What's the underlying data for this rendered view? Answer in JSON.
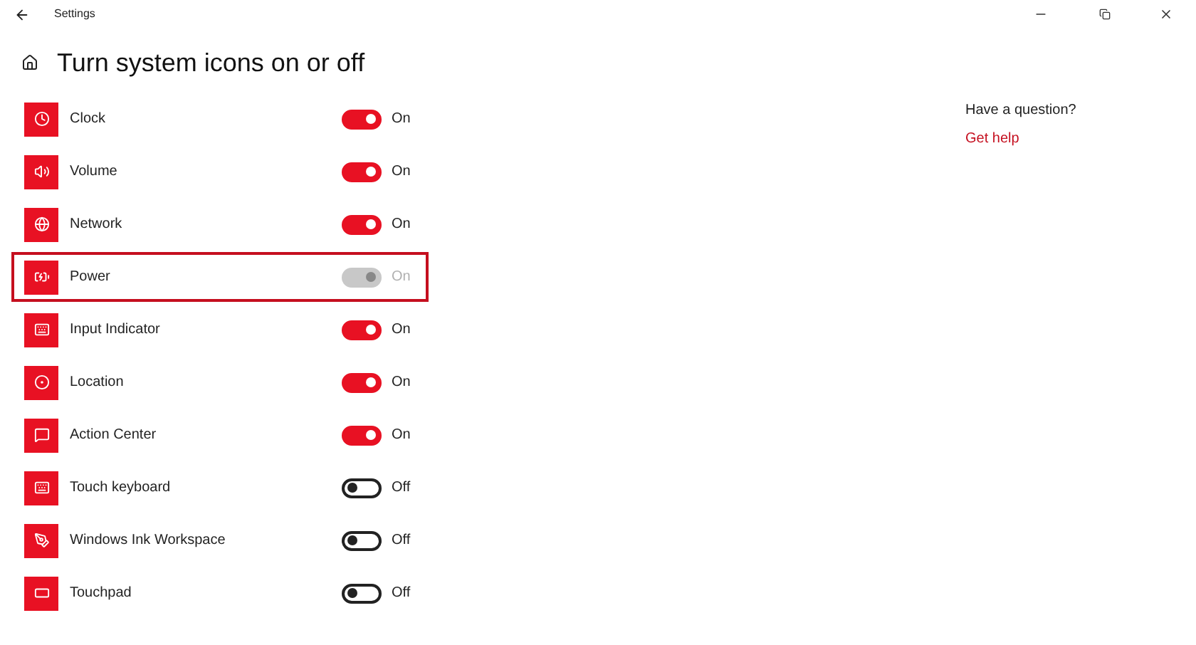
{
  "window": {
    "title": "Settings"
  },
  "page_title": "Turn system icons on or off",
  "items": [
    {
      "label": "Clock",
      "on": true,
      "disabled": false,
      "highlighted": false,
      "state_label": "On"
    },
    {
      "label": "Volume",
      "on": true,
      "disabled": false,
      "highlighted": false,
      "state_label": "On"
    },
    {
      "label": "Network",
      "on": true,
      "disabled": false,
      "highlighted": false,
      "state_label": "On"
    },
    {
      "label": "Power",
      "on": true,
      "disabled": true,
      "highlighted": true,
      "state_label": "On"
    },
    {
      "label": "Input Indicator",
      "on": true,
      "disabled": false,
      "highlighted": false,
      "state_label": "On"
    },
    {
      "label": "Location",
      "on": true,
      "disabled": false,
      "highlighted": false,
      "state_label": "On"
    },
    {
      "label": "Action Center",
      "on": true,
      "disabled": false,
      "highlighted": false,
      "state_label": "On"
    },
    {
      "label": "Touch keyboard",
      "on": false,
      "disabled": false,
      "highlighted": false,
      "state_label": "Off"
    },
    {
      "label": "Windows Ink Workspace",
      "on": false,
      "disabled": false,
      "highlighted": false,
      "state_label": "Off"
    },
    {
      "label": "Touchpad",
      "on": false,
      "disabled": false,
      "highlighted": false,
      "state_label": "Off"
    }
  ],
  "help": {
    "question": "Have a question?",
    "link": "Get help"
  }
}
